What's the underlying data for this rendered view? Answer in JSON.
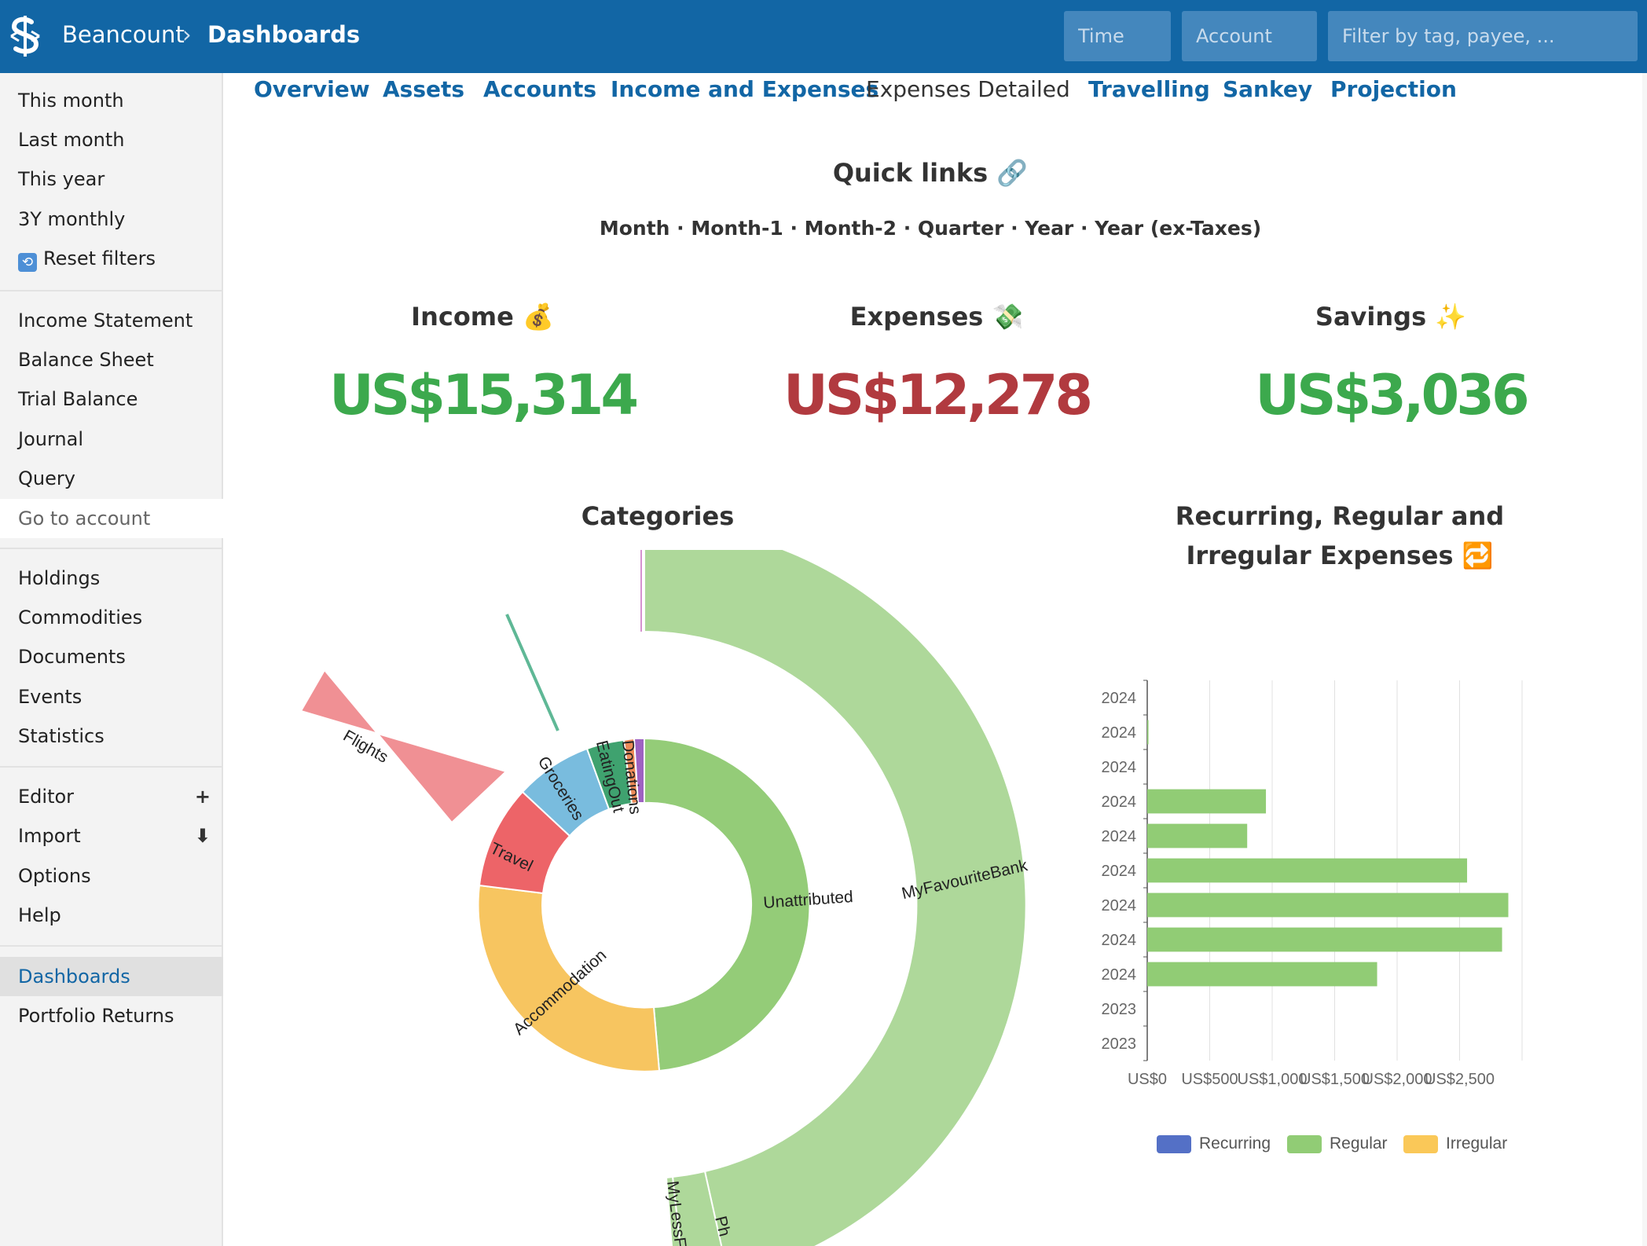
{
  "header": {
    "brand": "Beancount",
    "separator": "›",
    "page": "Dashboards",
    "time_placeholder": "Time",
    "account_placeholder": "Account",
    "filter_placeholder": "Filter by tag, payee, ..."
  },
  "sidebar": {
    "group1": [
      "This month",
      "Last month",
      "This year",
      "3Y monthly",
      "Reset filters"
    ],
    "group2": [
      "Income Statement",
      "Balance Sheet",
      "Trial Balance",
      "Journal",
      "Query",
      "Go to account"
    ],
    "group3": [
      "Holdings",
      "Commodities",
      "Documents",
      "Events",
      "Statistics"
    ],
    "group4": [
      "Editor",
      "Import",
      "Options",
      "Help"
    ],
    "group5": [
      "Dashboards",
      "Portfolio Returns"
    ],
    "editor_action": "+",
    "import_action": "⬇"
  },
  "tabs": [
    "Overview",
    "Assets",
    "Accounts",
    "Income and Expenses",
    "Expenses Detailed",
    "Travelling",
    "Sankey",
    "Projection"
  ],
  "quick_links": {
    "title": "Quick links 🔗",
    "links": "Month · Month-1 · Month-2 · Quarter · Year · Year (ex-Taxes)"
  },
  "stats": {
    "income": {
      "title": "Income 💰",
      "value": "US$15,314",
      "color": "#3ca94d"
    },
    "expenses": {
      "title": "Expenses 💸",
      "value": "US$12,278",
      "color": "#b13a3f"
    },
    "savings": {
      "title": "Savings ✨",
      "value": "US$3,036",
      "color": "#3ca94d"
    }
  },
  "categories_chart": {
    "title": "Categories",
    "inner_labels": [
      "Unattributed",
      "Accommodation",
      "Travel",
      "Groceries",
      "EatingOut",
      "Donations"
    ],
    "outer_labels": [
      "MyFavouriteBank",
      "MyLessFavourite",
      "Ph",
      "Flights"
    ],
    "colors": {
      "unattributed": "#94cc78",
      "outer_green": "#aed89a",
      "accommodation": "#f7c560",
      "travel": "#ed6468",
      "flights": "#f09094",
      "groceries": "#79bcde",
      "eating_out": "#3fa26f",
      "donations": "#ec8a58",
      "purple": "#9e62c2"
    }
  },
  "chart_data": {
    "type": "bar",
    "title": "Recurring, Regular and Irregular Expenses 🔁",
    "orientation": "horizontal",
    "categories": [
      "2024",
      "2024",
      "2024",
      "2024",
      "2024",
      "2024",
      "2024",
      "2024",
      "2024",
      "2023",
      "2023"
    ],
    "series": [
      {
        "name": "Recurring",
        "color": "#5470c6",
        "values": [
          0,
          0,
          0,
          0,
          0,
          0,
          0,
          0,
          0,
          0,
          0
        ]
      },
      {
        "name": "Regular",
        "color": "#91cc75",
        "values": [
          0,
          10,
          0,
          950,
          800,
          2560,
          2890,
          2840,
          1840,
          0,
          0
        ]
      },
      {
        "name": "Irregular",
        "color": "#fac858",
        "values": [
          0,
          0,
          0,
          0,
          0,
          0,
          0,
          0,
          0,
          0,
          0
        ]
      }
    ],
    "xticks": [
      "US$0",
      "US$500",
      "US$1,000",
      "US$1,500",
      "US$2,000",
      "US$2,500"
    ],
    "xlim": [
      0,
      3000
    ],
    "grid": true,
    "legend": "bottom"
  }
}
